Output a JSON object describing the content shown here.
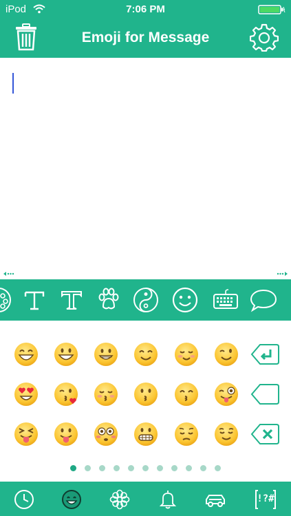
{
  "status_bar": {
    "carrier": "iPod",
    "time": "7:06 PM",
    "battery_color": "#4cd964"
  },
  "header": {
    "title": "Emoji for Message",
    "background": "#20b48c"
  },
  "editor": {
    "text": "",
    "caret_color": "#3355d8"
  },
  "style_bar": {
    "items": [
      "flower-circle-icon",
      "serif-t-icon",
      "outline-t-icon",
      "paw-icon",
      "yin-yang-icon",
      "smiley-icon",
      "keyboard-icon",
      "speech-bubble-icon"
    ]
  },
  "emoji_grid": {
    "rows": [
      [
        "grinning-smiling-eyes",
        "smiley-open-mouth",
        "grinning",
        "smiling-eyes",
        "relaxed",
        "winking"
      ],
      [
        "heart-eyes",
        "kissing-heart",
        "kissing-closed-eyes",
        "kissing",
        "kissing-smiling-eyes",
        "stuck-out-tongue-winking"
      ],
      [
        "stuck-out-tongue-closed-eyes",
        "stuck-out-tongue",
        "flushed",
        "grimacing",
        "pensive",
        "relieved"
      ]
    ],
    "side_keys": [
      "return-key-icon",
      "space-key-icon",
      "delete-key-icon"
    ]
  },
  "pagination": {
    "page_count": 11,
    "current_page": 1,
    "active_color": "#1fa884",
    "inactive_color": "#a7d8c8"
  },
  "tabbar": {
    "tabs": [
      "recent-clock-icon",
      "faces-icon",
      "flower-icon",
      "bell-icon",
      "car-icon",
      "symbols-icon"
    ],
    "symbols_label": "!?#",
    "selected": "faces-icon"
  }
}
